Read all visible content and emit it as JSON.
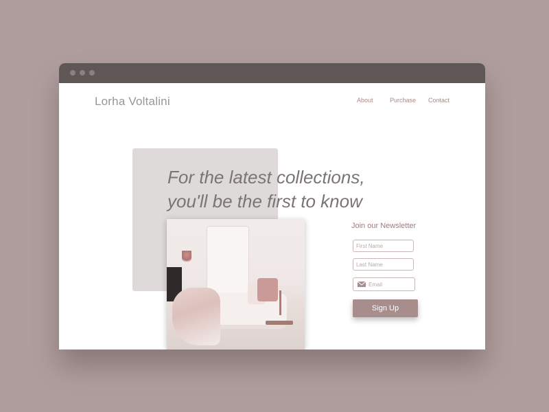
{
  "header": {
    "logo": "Lorha Voltalini",
    "nav": [
      "About",
      "Purchase",
      "Contact"
    ]
  },
  "hero": {
    "headline_line1": "For the latest collections,",
    "headline_line2": "you'll be the first to know"
  },
  "newsletter": {
    "title": "Join our Newsletter",
    "first_name_placeholder": "First Name",
    "last_name_placeholder": "Last Name",
    "email_placeholder": "Email",
    "signup_label": "Sign Up"
  },
  "colors": {
    "background": "#b09e9e",
    "title_bar": "#5f5656",
    "accent": "#a88d8d",
    "nav_text": "#a88a8a"
  },
  "icons": {
    "window_controls": [
      "window-dot-icon",
      "window-dot-icon",
      "window-dot-icon"
    ],
    "email": "mail-icon"
  }
}
